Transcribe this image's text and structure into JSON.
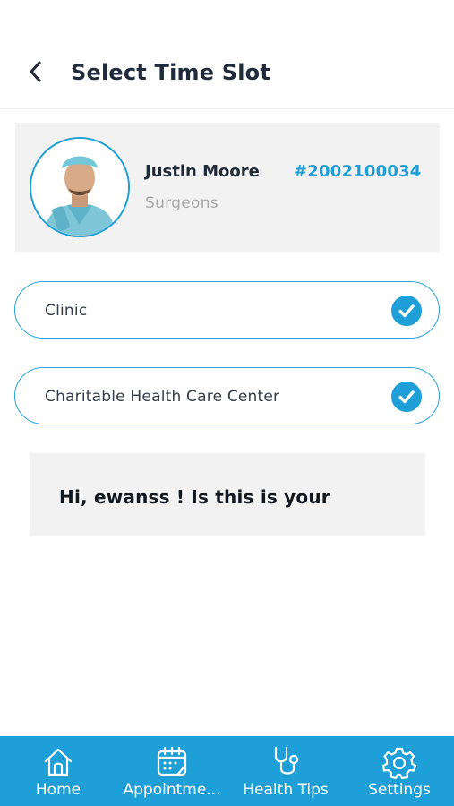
{
  "header": {
    "title": "Select Time Slot",
    "back_icon": "chevron-left-icon"
  },
  "doctor": {
    "name": "Justin Moore",
    "specialty": "Surgeons",
    "id": "#2002100034",
    "avatar_icon": "doctor-avatar"
  },
  "options": [
    {
      "label": "Clinic",
      "selected": true
    },
    {
      "label": "Charitable Health Care Center",
      "selected": true
    }
  ],
  "message": {
    "text": "Hi, ewanss ! Is this is your"
  },
  "tabbar": {
    "items": [
      {
        "label": "Home",
        "icon": "home-icon"
      },
      {
        "label": "Appointme...",
        "icon": "calendar-icon"
      },
      {
        "label": "Health Tips",
        "icon": "stethoscope-icon"
      },
      {
        "label": "Settings",
        "icon": "gear-icon"
      }
    ]
  },
  "colors": {
    "accent": "#1e9fd8",
    "card_bg": "#f2f2f2",
    "text": "#1f2a3a",
    "muted": "#a7a7a7"
  }
}
